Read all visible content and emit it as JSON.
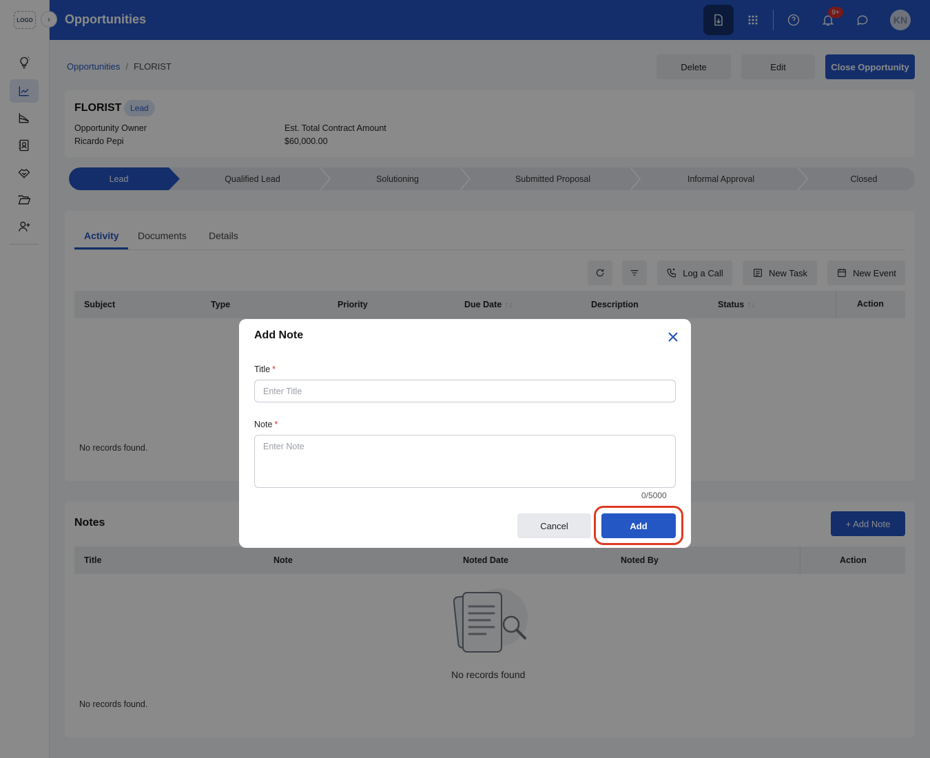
{
  "sidebar": {
    "logo_text": "LOGO",
    "expand_icon": "chevron-right-icon",
    "items": [
      {
        "name": "ideas",
        "icon": "lightbulb-icon"
      },
      {
        "name": "opportunities",
        "icon": "trending-chart-icon",
        "active": true
      },
      {
        "name": "analytics",
        "icon": "line-chart-icon"
      },
      {
        "name": "contacts",
        "icon": "contact-card-icon"
      },
      {
        "name": "deals",
        "icon": "handshake-icon"
      },
      {
        "name": "folders",
        "icon": "folder-open-icon"
      },
      {
        "name": "add-user",
        "icon": "user-plus-icon"
      }
    ]
  },
  "header": {
    "title": "Opportunities",
    "notification_badge": "9+",
    "avatar_initials": "KN",
    "color": "#2456c4"
  },
  "breadcrumb": {
    "parent": "Opportunities",
    "separator": "/",
    "current": "FLORIST"
  },
  "actions": {
    "delete_label": "Delete",
    "edit_label": "Edit",
    "close_label": "Close Opportunity"
  },
  "opportunity": {
    "name": "FLORIST",
    "status": "Lead",
    "owner_label": "Opportunity Owner",
    "owner_value": "Ricardo Pepi",
    "amount_label": "Est. Total Contract Amount",
    "amount_value": "$60,000.00"
  },
  "stages": [
    "Lead",
    "Qualified Lead",
    "Solutioning",
    "Submitted Proposal",
    "Informal Approval",
    "Closed"
  ],
  "tabs": [
    "Activity",
    "Documents",
    "Details"
  ],
  "activity": {
    "buttons": {
      "log_call": "Log a Call",
      "new_task": "New Task",
      "new_event": "New Event"
    },
    "columns": [
      "Subject",
      "Type",
      "Priority",
      "Due Date",
      "Description",
      "Status",
      "Action"
    ],
    "empty": "No records found."
  },
  "notes": {
    "title": "Notes",
    "add_label": "+ Add Note",
    "columns": [
      "Title",
      "Note",
      "Noted Date",
      "Noted By",
      "Action"
    ],
    "empty_illustration_text": "No records found",
    "empty": "No records found."
  },
  "modal": {
    "title": "Add Note",
    "title_label": "Title",
    "title_placeholder": "Enter Title",
    "title_value": "",
    "note_label": "Note",
    "note_placeholder": "Enter Note",
    "note_value": "",
    "required_mark": "*",
    "counter": "0/5000",
    "cancel_label": "Cancel",
    "add_label": "Add",
    "highlight_color": "#e03a22"
  }
}
